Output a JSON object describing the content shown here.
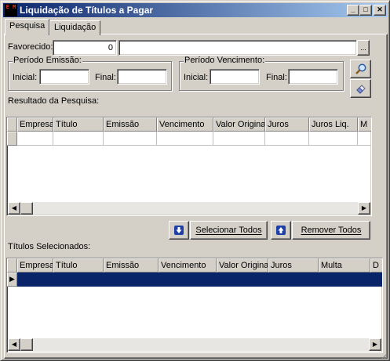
{
  "window": {
    "title": "Liquidação de Títulos a Pagar",
    "app_icon_text": "E M"
  },
  "titlebar_buttons": {
    "minimize": "_",
    "maximize": "□",
    "close": "✕"
  },
  "tabs": [
    {
      "label": "Pesquisa",
      "active": true
    },
    {
      "label": "Liquidação",
      "active": false
    }
  ],
  "favorecido": {
    "label": "Favorecido:",
    "code": "0",
    "name": "",
    "lookup_label": "..."
  },
  "periodo_emissao": {
    "title": "Período Emissão:",
    "inicial_label": "Inicial:",
    "inicial_value": "",
    "final_label": "Final:",
    "final_value": ""
  },
  "periodo_vencimento": {
    "title": "Período Vencimento:",
    "inicial_label": "Inicial:",
    "inicial_value": "",
    "final_label": "Final:",
    "final_value": ""
  },
  "side_buttons": {
    "search_icon": "magnifier-icon",
    "clear_icon": "eraser-icon"
  },
  "resultado": {
    "label": "Resultado da Pesquisa:",
    "columns": [
      "Empresa",
      "Título",
      "Emissão",
      "Vencimento",
      "Valor Original",
      "Juros",
      "Juros Liq.",
      "M"
    ],
    "rows": [
      [
        "",
        "",
        "",
        "",
        "",
        "",
        "",
        ""
      ]
    ]
  },
  "actions": {
    "select_all": "Selecionar Todos",
    "remove_all": "Remover Todos",
    "select_icon": "arrow-down-icon",
    "remove_icon": "arrow-up-icon"
  },
  "selecionados": {
    "label": "Títulos Selecionados:",
    "columns": [
      "Empresa",
      "Título",
      "Emissão",
      "Vencimento",
      "Valor Original",
      "Juros",
      "Multa",
      "D"
    ],
    "rows": [
      [
        "",
        "",
        "",
        "",
        "",
        "",
        "",
        ""
      ]
    ],
    "current_row_indicator": "▶"
  },
  "scrollbar": {
    "left_arrow": "◀",
    "right_arrow": "▶"
  },
  "colors": {
    "title_start": "#0a246a",
    "title_end": "#a6caf0",
    "face": "#d4d0c8",
    "selection": "#0a246a"
  }
}
